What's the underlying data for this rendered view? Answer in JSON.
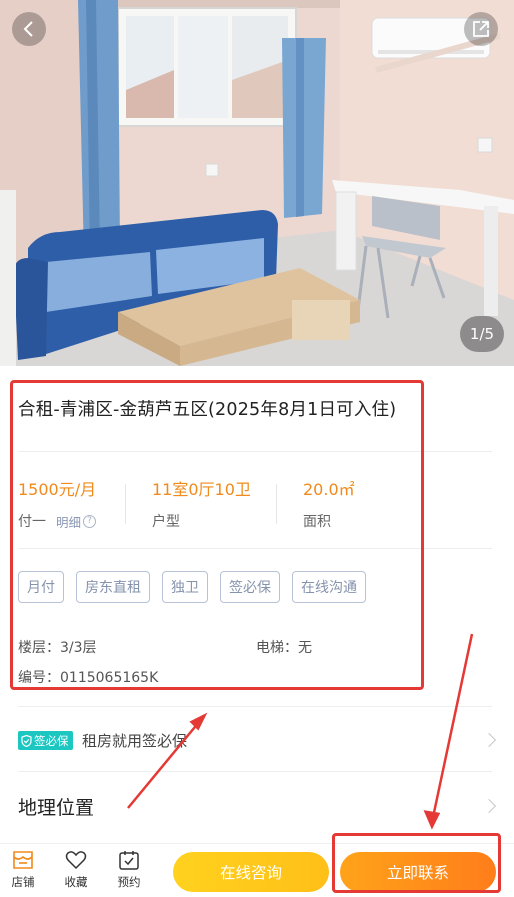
{
  "hero": {
    "counter": "1/5",
    "back_icon": "chevron-left-icon",
    "share_icon": "share-icon"
  },
  "listing": {
    "title": "合租-青浦区-金葫芦五区(2025年8月1日可入住)",
    "price": {
      "value": "1500元/月",
      "label": "付一",
      "detail": "明细",
      "help": "?"
    },
    "layout": {
      "value": "11室0厅10卫",
      "label": "户型"
    },
    "area": {
      "value": "20.0㎡",
      "label": "面积"
    },
    "tags": [
      "月付",
      "房东直租",
      "独卫",
      "签必保",
      "在线沟通"
    ],
    "floor": "楼层：3/3层",
    "elevator": "电梯：无",
    "code": "编号：0115065165K"
  },
  "guarantee": {
    "badge": "签必保",
    "text": "租房就用签必保"
  },
  "location": {
    "title": "地理位置"
  },
  "bottom_bar": {
    "nav": [
      {
        "label": "店铺",
        "icon": "store-icon"
      },
      {
        "label": "收藏",
        "icon": "heart-icon"
      },
      {
        "label": "预约",
        "icon": "calendar-check-icon"
      }
    ],
    "consult_label": "在线咨询",
    "contact_label": "立即联系"
  },
  "colors": {
    "accent_orange": "#f08a1c",
    "annotation_red": "#e53935",
    "badge_teal": "#1cc7c2",
    "consult_yellow": "#ffc61a",
    "contact_orange": "#ff8c1a"
  }
}
